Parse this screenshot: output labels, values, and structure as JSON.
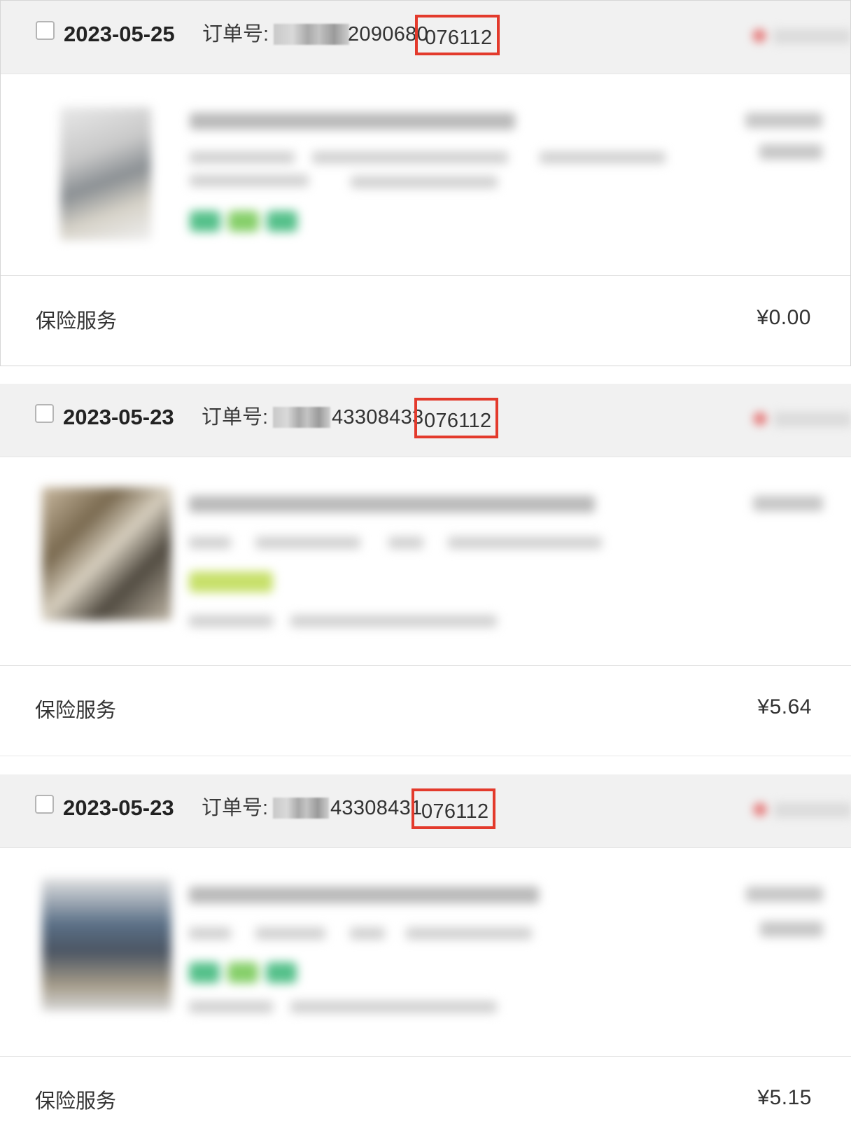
{
  "orders": [
    {
      "date": "2023-05-25",
      "order_no_label": "订单号:",
      "order_no_visible_prefix": "2090680",
      "order_no_highlighted_suffix": "076112",
      "service_label": "保险服务",
      "service_price": "¥0.00"
    },
    {
      "date": "2023-05-23",
      "order_no_label": "订单号:",
      "order_no_visible_prefix": "43308433",
      "order_no_highlighted_suffix": "076112",
      "service_label": "保险服务",
      "service_price": "¥5.64"
    },
    {
      "date": "2023-05-23",
      "order_no_label": "订单号:",
      "order_no_visible_prefix": "43308431",
      "order_no_highlighted_suffix": "076112",
      "service_label": "保险服务",
      "service_price": "¥5.15"
    }
  ],
  "colors": {
    "highlight_border": "#e33a2c",
    "header_background": "#f1f1f1",
    "text": "#333333"
  }
}
